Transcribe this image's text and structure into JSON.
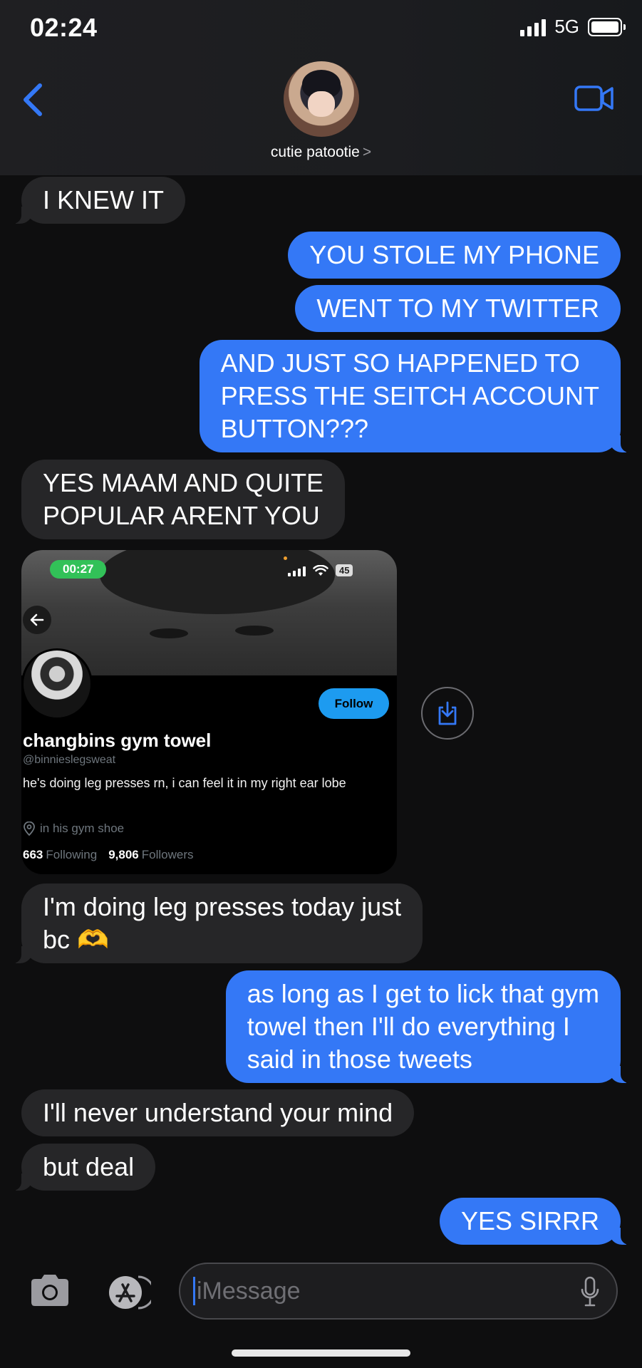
{
  "status_bar": {
    "time": "02:24",
    "network": "5G"
  },
  "header": {
    "contact_name": "cutie patootie",
    "chevron": ">"
  },
  "messages": [
    {
      "text": "I KNEW IT"
    },
    {
      "text": "YOU STOLE MY PHONE"
    },
    {
      "text": "WENT TO MY TWITTER"
    },
    {
      "text": "AND JUST SO HAPPENED TO\nPRESS THE SEITCH ACCOUNT\nBUTTON???"
    },
    {
      "text": "YES MAAM AND QUITE\nPOPULAR ARENT YOU"
    },
    {
      "text": "I'm doing leg presses today just\nbc 🫶"
    },
    {
      "text": "as long as I get to lick that gym\ntowel then I'll do everything I\nsaid in those tweets"
    },
    {
      "text": "I'll never understand your mind"
    },
    {
      "text": "but deal"
    },
    {
      "text": "YES SIRRR"
    }
  ],
  "attachment": {
    "time": "00:27",
    "battery": "45",
    "follow_label": "Follow",
    "name": "changbins gym towel",
    "handle": "@binnieslegsweat",
    "bio": "he's doing leg presses rn, i can feel it in my right ear lobe",
    "location": "in his gym shoe",
    "following_count": "663",
    "following_label": "Following",
    "followers_count": "9,806",
    "followers_label": "Followers"
  },
  "input": {
    "placeholder": "iMessage"
  },
  "colors": {
    "outgoing": "#3478f6",
    "incoming": "#262628",
    "background": "#0e0e0f",
    "follow": "#1d9bf0"
  }
}
